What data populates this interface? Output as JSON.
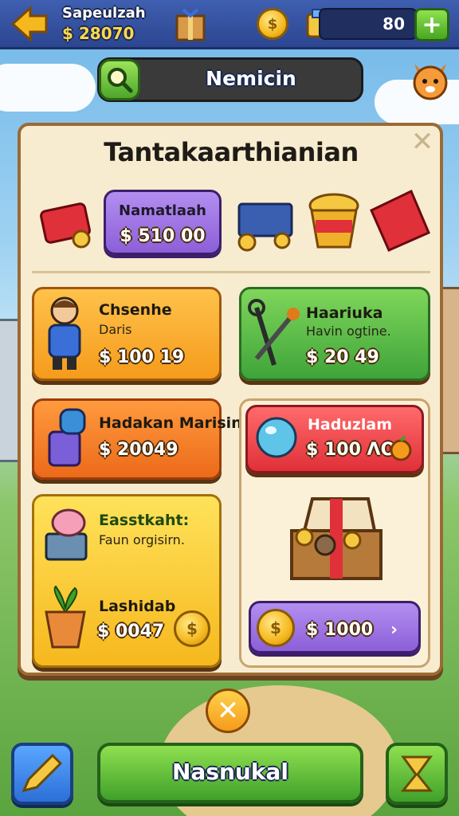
{
  "header": {
    "player_name": "Sapeulzah",
    "money": "$ 28070",
    "currency_value": "80",
    "plus_label": "+"
  },
  "search": {
    "label": "Nemicin"
  },
  "panel": {
    "title": "Tantakaarthianian",
    "close_label": "✕",
    "featured": {
      "title": "Namatlaah",
      "price": "$ 510 00"
    }
  },
  "cards": {
    "character": {
      "title": "Chsenhe",
      "subtitle": "Daris",
      "price": "$ 100 19"
    },
    "tool": {
      "title": "Haariuka",
      "subtitle": "Havin ogtine.",
      "price": "$ 20 49"
    },
    "cannon": {
      "title": "Hadakan Marisin",
      "price": "$ 20049"
    },
    "potion": {
      "title": "Haduzlam",
      "price": "$ 100 ΛΟ"
    },
    "pig": {
      "title": "Easstkaht:",
      "subtitle": "Faun orgisirn.",
      "plant_title": "Lashidab",
      "price": "$ 0047"
    },
    "chest": {
      "price": "$ 1000"
    }
  },
  "footer": {
    "close_label": "✕",
    "main_button_label": "Nasnukal"
  },
  "icons": {
    "back": "back-arrow-icon",
    "box": "gift-box-icon",
    "coin": "coin-icon",
    "bag": "treasure-bag-icon",
    "search": "magnifier-icon",
    "mascot": "fox-mascot-icon"
  }
}
